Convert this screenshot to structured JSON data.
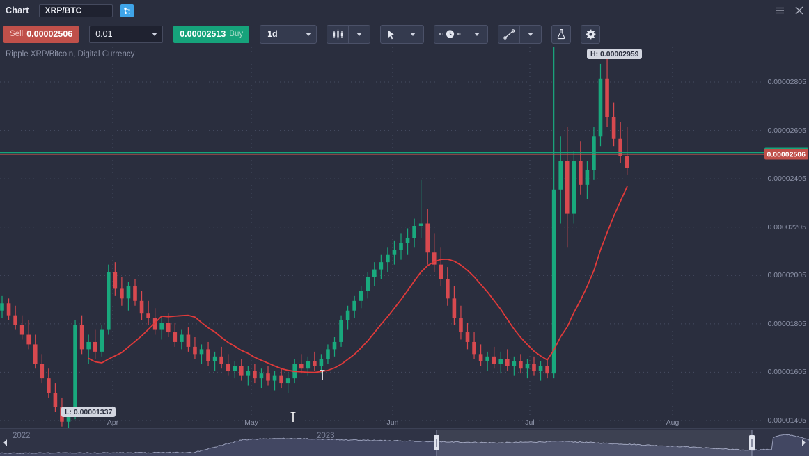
{
  "window": {
    "title": "Chart",
    "symbol": "XRP/BTC",
    "symbol_icon": "network-nodes-icon",
    "menu_icon": "hamburger-menu-icon",
    "close_icon": "close-icon"
  },
  "toolbar": {
    "sell_word": "Sell",
    "sell_price": "0.00002506",
    "buy_word": "Buy",
    "buy_price": "0.00002513",
    "quantity": "0.01",
    "timeframe": "1d",
    "icons": [
      "candlestick-chart-icon",
      "cursor-pointer-icon",
      "clock-time-icon",
      "trend-line-icon",
      "flask-indicators-icon",
      "gear-settings-icon"
    ]
  },
  "chart": {
    "subtitle": "Ripple XRP/Bitcoin, Digital Currency",
    "high_marker": "H: 0.00002959",
    "low_marker": "L: 0.00001337",
    "bid_tag": "0.00002513",
    "ask_tag": "0.00002506",
    "bid_color": "#16a37b",
    "ask_color": "#c0504a",
    "up_color": "#19a97d",
    "down_color": "#d8494f",
    "ma_color": "#e03a3a",
    "background": "#2a2e3e"
  },
  "navigator": {
    "year_left": "2022",
    "year_right": "2023",
    "left_arrow_icon": "scroll-left-arrow-icon",
    "right_arrow_icon": "scroll-right-arrow-icon"
  },
  "chart_data": {
    "type": "candlestick",
    "title": "Ripple XRP/Bitcoin, Digital Currency",
    "symbol": "XRP/BTC",
    "interval": "1d",
    "xlabel": "",
    "ylabel": "",
    "ylim": [
      1.337e-05,
      2.959e-05
    ],
    "grid": true,
    "y_ticks": [
      "0.00002805",
      "0.00002605",
      "0.00002405",
      "0.00002205",
      "0.00002005",
      "0.00001805",
      "0.00001605",
      "0.00001405"
    ],
    "y_tick_values": [
      2.805e-05,
      2.605e-05,
      2.405e-05,
      2.205e-05,
      2.005e-05,
      1.805e-05,
      1.605e-05,
      1.405e-05
    ],
    "x_ticks": [
      "Apr",
      "May",
      "Jun",
      "Jul",
      "Aug"
    ],
    "high": 2.959e-05,
    "low": 1.337e-05,
    "bid": 2.513e-05,
    "ask": 2.506e-05,
    "overlays": [
      {
        "name": "moving-average",
        "color": "#e03a3a",
        "type": "line"
      }
    ],
    "candles": [
      {
        "o": 1.86e-05,
        "h": 1.92e-05,
        "l": 1.83e-05,
        "c": 1.89e-05
      },
      {
        "o": 1.89e-05,
        "h": 1.91e-05,
        "l": 1.82e-05,
        "c": 1.84e-05
      },
      {
        "o": 1.84e-05,
        "h": 1.88e-05,
        "l": 1.78e-05,
        "c": 1.8e-05
      },
      {
        "o": 1.8e-05,
        "h": 1.84e-05,
        "l": 1.74e-05,
        "c": 1.76e-05
      },
      {
        "o": 1.76e-05,
        "h": 1.82e-05,
        "l": 1.7e-05,
        "c": 1.72e-05
      },
      {
        "o": 1.72e-05,
        "h": 1.76e-05,
        "l": 1.62e-05,
        "c": 1.64e-05
      },
      {
        "o": 1.64e-05,
        "h": 1.68e-05,
        "l": 1.56e-05,
        "c": 1.58e-05
      },
      {
        "o": 1.58e-05,
        "h": 1.62e-05,
        "l": 1.5e-05,
        "c": 1.52e-05
      },
      {
        "o": 1.52e-05,
        "h": 1.56e-05,
        "l": 1.44e-05,
        "c": 1.46e-05
      },
      {
        "o": 1.46e-05,
        "h": 1.5e-05,
        "l": 1.38e-05,
        "c": 1.4e-05
      },
      {
        "o": 1.4e-05,
        "h": 1.46e-05,
        "l": 1.337e-05,
        "c": 1.43e-05
      },
      {
        "o": 1.43e-05,
        "h": 1.82e-05,
        "l": 1.41e-05,
        "c": 1.8e-05
      },
      {
        "o": 1.8e-05,
        "h": 1.84e-05,
        "l": 1.68e-05,
        "c": 1.7e-05
      },
      {
        "o": 1.7e-05,
        "h": 1.76e-05,
        "l": 1.64e-05,
        "c": 1.73e-05
      },
      {
        "o": 1.73e-05,
        "h": 1.78e-05,
        "l": 1.66e-05,
        "c": 1.69e-05
      },
      {
        "o": 1.69e-05,
        "h": 1.8e-05,
        "l": 1.67e-05,
        "c": 1.78e-05
      },
      {
        "o": 1.78e-05,
        "h": 2.05e-05,
        "l": 1.76e-05,
        "c": 2.02e-05
      },
      {
        "o": 2.02e-05,
        "h": 2.06e-05,
        "l": 1.92e-05,
        "c": 1.95e-05
      },
      {
        "o": 1.95e-05,
        "h": 2e-05,
        "l": 1.88e-05,
        "c": 1.91e-05
      },
      {
        "o": 1.91e-05,
        "h": 1.98e-05,
        "l": 1.86e-05,
        "c": 1.96e-05
      },
      {
        "o": 1.96e-05,
        "h": 1.99e-05,
        "l": 1.88e-05,
        "c": 1.9e-05
      },
      {
        "o": 1.9e-05,
        "h": 1.94e-05,
        "l": 1.82e-05,
        "c": 1.85e-05
      },
      {
        "o": 1.85e-05,
        "h": 1.9e-05,
        "l": 1.8e-05,
        "c": 1.83e-05
      },
      {
        "o": 1.83e-05,
        "h": 1.87e-05,
        "l": 1.76e-05,
        "c": 1.78e-05
      },
      {
        "o": 1.78e-05,
        "h": 1.83e-05,
        "l": 1.74e-05,
        "c": 1.81e-05
      },
      {
        "o": 1.81e-05,
        "h": 1.85e-05,
        "l": 1.75e-05,
        "c": 1.77e-05
      },
      {
        "o": 1.77e-05,
        "h": 1.81e-05,
        "l": 1.71e-05,
        "c": 1.73e-05
      },
      {
        "o": 1.73e-05,
        "h": 1.78e-05,
        "l": 1.7e-05,
        "c": 1.76e-05
      },
      {
        "o": 1.76e-05,
        "h": 1.79e-05,
        "l": 1.69e-05,
        "c": 1.71e-05
      },
      {
        "o": 1.71e-05,
        "h": 1.75e-05,
        "l": 1.66e-05,
        "c": 1.68e-05
      },
      {
        "o": 1.68e-05,
        "h": 1.72e-05,
        "l": 1.64e-05,
        "c": 1.7e-05
      },
      {
        "o": 1.7e-05,
        "h": 1.73e-05,
        "l": 1.63e-05,
        "c": 1.65e-05
      },
      {
        "o": 1.65e-05,
        "h": 1.69e-05,
        "l": 1.61e-05,
        "c": 1.67e-05
      },
      {
        "o": 1.67e-05,
        "h": 1.71e-05,
        "l": 1.62e-05,
        "c": 1.64e-05
      },
      {
        "o": 1.64e-05,
        "h": 1.68e-05,
        "l": 1.59e-05,
        "c": 1.61e-05
      },
      {
        "o": 1.61e-05,
        "h": 1.65e-05,
        "l": 1.58e-05,
        "c": 1.63e-05
      },
      {
        "o": 1.63e-05,
        "h": 1.66e-05,
        "l": 1.57e-05,
        "c": 1.59e-05
      },
      {
        "o": 1.59e-05,
        "h": 1.63e-05,
        "l": 1.55e-05,
        "c": 1.61e-05
      },
      {
        "o": 1.61e-05,
        "h": 1.64e-05,
        "l": 1.56e-05,
        "c": 1.58e-05
      },
      {
        "o": 1.58e-05,
        "h": 1.62e-05,
        "l": 1.54e-05,
        "c": 1.6e-05
      },
      {
        "o": 1.6e-05,
        "h": 1.63e-05,
        "l": 1.55e-05,
        "c": 1.57e-05
      },
      {
        "o": 1.57e-05,
        "h": 1.61e-05,
        "l": 1.53e-05,
        "c": 1.59e-05
      },
      {
        "o": 1.59e-05,
        "h": 1.62e-05,
        "l": 1.54e-05,
        "c": 1.56e-05
      },
      {
        "o": 1.56e-05,
        "h": 1.6e-05,
        "l": 1.52e-05,
        "c": 1.58e-05
      },
      {
        "o": 1.58e-05,
        "h": 1.66e-05,
        "l": 1.56e-05,
        "c": 1.64e-05
      },
      {
        "o": 1.64e-05,
        "h": 1.68e-05,
        "l": 1.6e-05,
        "c": 1.62e-05
      },
      {
        "o": 1.62e-05,
        "h": 1.67e-05,
        "l": 1.59e-05,
        "c": 1.65e-05
      },
      {
        "o": 1.65e-05,
        "h": 1.69e-05,
        "l": 1.61e-05,
        "c": 1.63e-05
      },
      {
        "o": 1.63e-05,
        "h": 1.68e-05,
        "l": 1.6e-05,
        "c": 1.66e-05
      },
      {
        "o": 1.66e-05,
        "h": 1.72e-05,
        "l": 1.64e-05,
        "c": 1.7e-05
      },
      {
        "o": 1.7e-05,
        "h": 1.75e-05,
        "l": 1.67e-05,
        "c": 1.73e-05
      },
      {
        "o": 1.73e-05,
        "h": 1.84e-05,
        "l": 1.71e-05,
        "c": 1.82e-05
      },
      {
        "o": 1.82e-05,
        "h": 1.88e-05,
        "l": 1.78e-05,
        "c": 1.86e-05
      },
      {
        "o": 1.86e-05,
        "h": 1.92e-05,
        "l": 1.83e-05,
        "c": 1.9e-05
      },
      {
        "o": 1.9e-05,
        "h": 1.96e-05,
        "l": 1.87e-05,
        "c": 1.94e-05
      },
      {
        "o": 1.94e-05,
        "h": 2.02e-05,
        "l": 1.91e-05,
        "c": 2e-05
      },
      {
        "o": 2e-05,
        "h": 2.06e-05,
        "l": 1.96e-05,
        "c": 2.03e-05
      },
      {
        "o": 2.03e-05,
        "h": 2.09e-05,
        "l": 1.99e-05,
        "c": 2.06e-05
      },
      {
        "o": 2.06e-05,
        "h": 2.12e-05,
        "l": 2.02e-05,
        "c": 2.09e-05
      },
      {
        "o": 2.09e-05,
        "h": 2.15e-05,
        "l": 2.05e-05,
        "c": 2.11e-05
      },
      {
        "o": 2.11e-05,
        "h": 2.18e-05,
        "l": 2.07e-05,
        "c": 2.14e-05
      },
      {
        "o": 2.14e-05,
        "h": 2.2e-05,
        "l": 2.09e-05,
        "c": 2.16e-05
      },
      {
        "o": 2.16e-05,
        "h": 2.24e-05,
        "l": 2.12e-05,
        "c": 2.21e-05
      },
      {
        "o": 2.21e-05,
        "h": 2.4e-05,
        "l": 2.16e-05,
        "c": 2.22e-05
      },
      {
        "o": 2.22e-05,
        "h": 2.28e-05,
        "l": 2.05e-05,
        "c": 2.1e-05
      },
      {
        "o": 2.1e-05,
        "h": 2.18e-05,
        "l": 2.02e-05,
        "c": 2.05e-05
      },
      {
        "o": 2.05e-05,
        "h": 2.12e-05,
        "l": 1.96e-05,
        "c": 1.99e-05
      },
      {
        "o": 1.99e-05,
        "h": 2.04e-05,
        "l": 1.88e-05,
        "c": 1.91e-05
      },
      {
        "o": 1.91e-05,
        "h": 1.96e-05,
        "l": 1.8e-05,
        "c": 1.83e-05
      },
      {
        "o": 1.83e-05,
        "h": 1.88e-05,
        "l": 1.74e-05,
        "c": 1.77e-05
      },
      {
        "o": 1.77e-05,
        "h": 1.81e-05,
        "l": 1.7e-05,
        "c": 1.73e-05
      },
      {
        "o": 1.73e-05,
        "h": 1.77e-05,
        "l": 1.66e-05,
        "c": 1.68e-05
      },
      {
        "o": 1.68e-05,
        "h": 1.72e-05,
        "l": 1.63e-05,
        "c": 1.65e-05
      },
      {
        "o": 1.65e-05,
        "h": 1.69e-05,
        "l": 1.61e-05,
        "c": 1.67e-05
      },
      {
        "o": 1.67e-05,
        "h": 1.71e-05,
        "l": 1.62e-05,
        "c": 1.64e-05
      },
      {
        "o": 1.64e-05,
        "h": 1.69e-05,
        "l": 1.6e-05,
        "c": 1.66e-05
      },
      {
        "o": 1.66e-05,
        "h": 1.7e-05,
        "l": 1.61e-05,
        "c": 1.63e-05
      },
      {
        "o": 1.63e-05,
        "h": 1.67e-05,
        "l": 1.59e-05,
        "c": 1.65e-05
      },
      {
        "o": 1.65e-05,
        "h": 1.68e-05,
        "l": 1.6e-05,
        "c": 1.62e-05
      },
      {
        "o": 1.62e-05,
        "h": 1.66e-05,
        "l": 1.58e-05,
        "c": 1.64e-05
      },
      {
        "o": 1.64e-05,
        "h": 1.67e-05,
        "l": 1.59e-05,
        "c": 1.61e-05
      },
      {
        "o": 1.61e-05,
        "h": 1.65e-05,
        "l": 1.57e-05,
        "c": 1.63e-05
      },
      {
        "o": 1.63e-05,
        "h": 1.66e-05,
        "l": 1.58e-05,
        "c": 1.6e-05
      },
      {
        "o": 1.6e-05,
        "h": 2.96e-05,
        "l": 1.58e-05,
        "c": 2.36e-05
      },
      {
        "o": 2.36e-05,
        "h": 2.58e-05,
        "l": 2.22e-05,
        "c": 2.48e-05
      },
      {
        "o": 2.48e-05,
        "h": 2.62e-05,
        "l": 2.12e-05,
        "c": 2.26e-05
      },
      {
        "o": 2.26e-05,
        "h": 2.52e-05,
        "l": 2.22e-05,
        "c": 2.48e-05
      },
      {
        "o": 2.48e-05,
        "h": 2.56e-05,
        "l": 2.34e-05,
        "c": 2.38e-05
      },
      {
        "o": 2.38e-05,
        "h": 2.48e-05,
        "l": 2.32e-05,
        "c": 2.44e-05
      },
      {
        "o": 2.44e-05,
        "h": 2.62e-05,
        "l": 2.4e-05,
        "c": 2.58e-05
      },
      {
        "o": 2.58e-05,
        "h": 2.88e-05,
        "l": 2.54e-05,
        "c": 2.82e-05
      },
      {
        "o": 2.82e-05,
        "h": 2.92e-05,
        "l": 2.62e-05,
        "c": 2.66e-05
      },
      {
        "o": 2.66e-05,
        "h": 2.72e-05,
        "l": 2.54e-05,
        "c": 2.57e-05
      },
      {
        "o": 2.57e-05,
        "h": 2.64e-05,
        "l": 2.47e-05,
        "c": 2.5e-05
      },
      {
        "o": 2.5e-05,
        "h": 2.62e-05,
        "l": 2.42e-05,
        "c": 2.45e-05
      }
    ]
  }
}
